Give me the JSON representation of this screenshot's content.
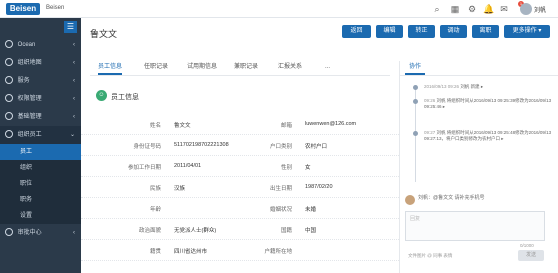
{
  "topbar": {
    "logo": "Beisen",
    "logo_sub": "Beisen",
    "icons": [
      "search-icon",
      "grid-icon",
      "settings-icon",
      "notification-icon",
      "mail-icon"
    ],
    "badge": "1",
    "user_name": "刘帆"
  },
  "sidebar": {
    "items": [
      {
        "label": "Ocean",
        "top": 0
      },
      {
        "label": "组织地图",
        "top": 0
      },
      {
        "label": "服务",
        "top": 0
      },
      {
        "label": "权限管理",
        "top": 0
      },
      {
        "label": "基础管理",
        "top": 0
      },
      {
        "label": "组织员工",
        "top": 0
      }
    ],
    "sub_items": [
      "员工",
      "组织",
      "职位",
      "职务",
      "设置"
    ],
    "footer_item": "审批中心"
  },
  "main": {
    "title": "鲁文文",
    "buttons": [
      "返回",
      "编辑",
      "转正",
      "调动",
      "离职",
      "更多操作"
    ],
    "tabs": [
      "员工信息",
      "任职记录",
      "试用期信息",
      "兼职记录",
      "汇报关系",
      "..."
    ],
    "section_title": "员工信息",
    "fields": [
      {
        "label": "姓名",
        "value": "鲁文文",
        "label2": "邮箱",
        "value2": "luwenwen@126.com"
      },
      {
        "label": "身份证号码",
        "value": "511702198702221308",
        "label2": "户口类别",
        "value2": "农村户口"
      },
      {
        "label": "参加工作日期",
        "value": "2011/04/01",
        "label2": "性别",
        "value2": "女"
      },
      {
        "label": "民族",
        "value": "汉族",
        "label2": "出生日期",
        "value2": "1987/02/20"
      },
      {
        "label": "年龄",
        "value": "",
        "label2": "婚姻状况",
        "value2": "未婚"
      },
      {
        "label": "政治面貌",
        "value": "无党派人士(群众)",
        "label2": "国籍",
        "value2": "中国"
      },
      {
        "label": "籍贯",
        "value": "四川省达州市",
        "label2": "户籍所在地",
        "value2": ""
      }
    ]
  },
  "side_panel": {
    "title": "协作",
    "timeline": [
      {
        "time": "2016/09/13 09:26",
        "text": "刘帆 新建 ▸"
      },
      {
        "time": "09:26",
        "text": "刘帆 将组织时间从2016/09/13 09:25:39修改为2016/09/13 09:25:46 ▸"
      },
      {
        "time": "09:27",
        "text": "刘帆 将组织时间从2016/09/13 09:25:48修改为2016/09/13 09:27:13，将户口类别修改为农村户口 ▸"
      }
    ],
    "composer_text": "刘帆：@鲁文文 请补充手机号",
    "composer_placeholder": "回复",
    "count": "0/1000",
    "tools": "文件图片   @ 同事   表情",
    "send": "发送"
  }
}
